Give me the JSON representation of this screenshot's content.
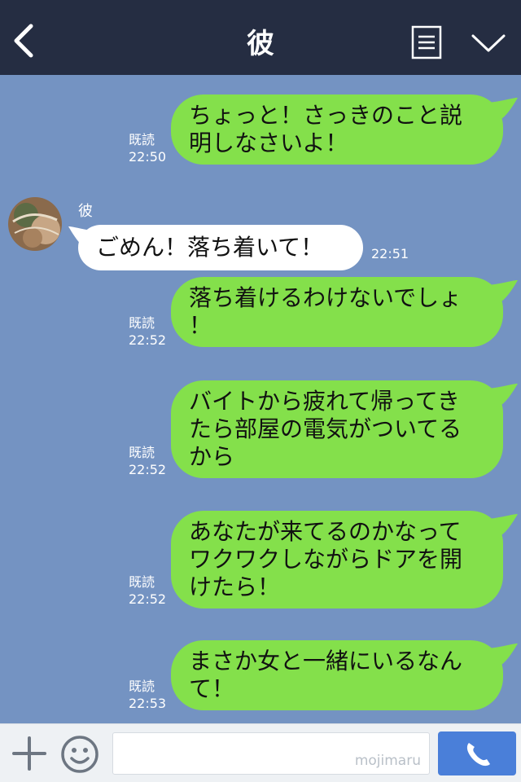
{
  "header": {
    "title": "彼"
  },
  "chat": {
    "sender_name": "彼",
    "messages": [
      {
        "dir": "out",
        "text": "ちょっと！さっきのこと説\n明しなさいよ！",
        "read": "既読",
        "time": "22:50"
      },
      {
        "dir": "in",
        "text": "ごめん！落ち着いて！",
        "time": "22:51"
      },
      {
        "dir": "out",
        "text": "落ち着けるわけないでしょ\n！",
        "read": "既読",
        "time": "22:52"
      },
      {
        "dir": "out",
        "text": "バイトから疲れて帰ってき\nたら部屋の電気がついてる\nから",
        "read": "既読",
        "time": "22:52"
      },
      {
        "dir": "out",
        "text": "あなたが来てるのかなって\nワクワクしながらドアを開\nけたら！",
        "read": "既読",
        "time": "22:52"
      },
      {
        "dir": "out",
        "text": "まさか女と一緒にいるなん\nて！",
        "read": "既読",
        "time": "22:53"
      }
    ]
  },
  "footer": {
    "watermark": "mojimaru"
  },
  "icons": {
    "back": "chevron-left-icon",
    "menu": "notes-icon",
    "down": "chevron-down-icon",
    "plus": "plus-icon",
    "emoji": "smiley-icon",
    "call": "phone-icon"
  },
  "colors": {
    "header": "#252d42",
    "chat_bg": "#7493c2",
    "bubble_out": "#84e04b",
    "bubble_in": "#ffffff",
    "call_button": "#4a7fd9"
  }
}
